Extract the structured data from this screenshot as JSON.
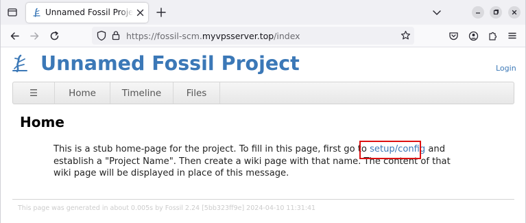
{
  "browser": {
    "tab": {
      "title": "Unnamed Fossil Project: I",
      "close_icon": "close-icon",
      "favicon": "fossil-logo-icon"
    },
    "url": {
      "scheme": "https://fossil-scm.",
      "host": "myvpsserver.top",
      "path": "/index"
    }
  },
  "site": {
    "title": "Unnamed Fossil Project",
    "login": "Login",
    "accent_color": "#3b78b7"
  },
  "menu": {
    "hamburger": "☰",
    "items": [
      {
        "label": "Home"
      },
      {
        "label": "Timeline"
      },
      {
        "label": "Files"
      }
    ]
  },
  "page": {
    "heading": "Home",
    "body_before": "This is a stub home-page for the project. To fill in this page, first go to ",
    "link_text": "setup/config",
    "body_after": " and establish a \"Project Name\". Then create a wiki page with that name. The content of that wiki page will be displayed in place of this message.",
    "footer": "This page was generated in about 0.005s by Fossil 2.24 [5bb323ff9e] 2024-04-10 11:31:41"
  },
  "annotation": {
    "highlight_color": "#d11111"
  }
}
